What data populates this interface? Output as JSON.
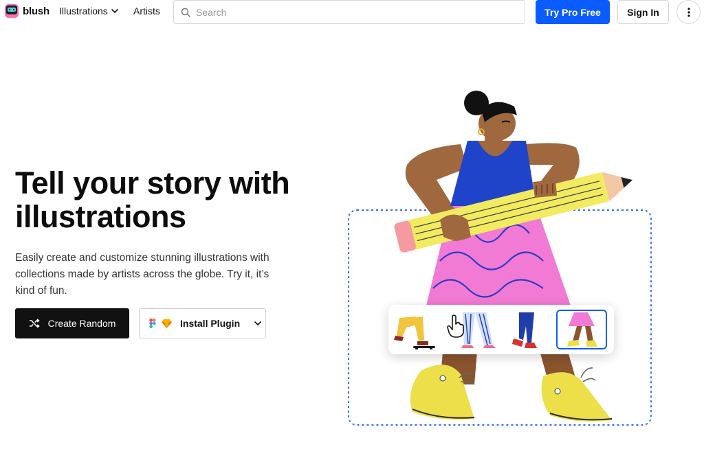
{
  "header": {
    "brand": "blush",
    "nav": {
      "illustrations": "Illustrations",
      "artists": "Artists"
    },
    "search_placeholder": "Search",
    "try_pro": "Try Pro Free",
    "sign_in": "Sign In"
  },
  "hero": {
    "title": "Tell your story with illustrations",
    "subtitle": "Easily create and customize stunning illustrations with collections made by artists across the globe. Try it, it’s kind of fun.",
    "create_random": "Create Random",
    "install_plugin": "Install Plugin"
  },
  "colors": {
    "accent": "#0a5cff",
    "dark_button": "#111111",
    "skin": "#a0683e",
    "top": "#1f44c9",
    "skirt": "#f17ad4",
    "pencil": "#f2ea60",
    "shoes": "#ecdf4a"
  },
  "icons": [
    "chevron-down-icon",
    "search-icon",
    "more-vertical-icon",
    "shuffle-icon",
    "figma-icon",
    "sketch-icon",
    "pointer-hand-icon"
  ]
}
